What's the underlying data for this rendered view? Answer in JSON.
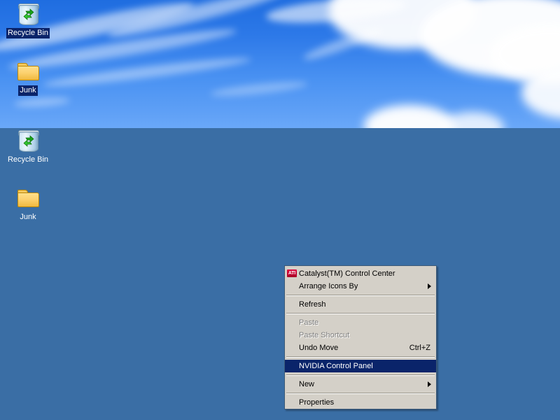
{
  "desktop": {
    "background_color": "#3a6ea5",
    "wallpaper_name": "bliss-sky",
    "icons_top": [
      {
        "name": "Recycle Bin",
        "icon": "recycle-bin-icon",
        "selected": true
      },
      {
        "name": "Junk",
        "icon": "folder-icon",
        "selected": true
      }
    ],
    "icons_bottom": [
      {
        "name": "Recycle Bin",
        "icon": "recycle-bin-icon",
        "selected": false
      },
      {
        "name": "Junk",
        "icon": "folder-icon",
        "selected": false
      }
    ]
  },
  "context_menu": {
    "accent_color": "#0a246a",
    "face_color": "#d4d0c8",
    "border_color": "#3c5a78",
    "items": [
      {
        "label": "Catalyst(TM) Control Center",
        "icon": "ati-logo-icon",
        "icon_text": "ATI",
        "state": "normal",
        "accel": "",
        "submenu": false
      },
      {
        "label": "Arrange Icons By",
        "state": "normal",
        "accel": "",
        "submenu": true
      },
      {
        "separator": true
      },
      {
        "label": "Refresh",
        "state": "normal",
        "accel": "",
        "submenu": false
      },
      {
        "separator": true
      },
      {
        "label": "Paste",
        "state": "disabled",
        "accel": "",
        "submenu": false
      },
      {
        "label": "Paste Shortcut",
        "state": "disabled",
        "accel": "",
        "submenu": false
      },
      {
        "label": "Undo Move",
        "state": "normal",
        "accel": "Ctrl+Z",
        "submenu": false
      },
      {
        "separator": true
      },
      {
        "label": "NVIDIA Control Panel",
        "state": "selected",
        "accel": "",
        "submenu": false
      },
      {
        "separator": true
      },
      {
        "label": "New",
        "state": "normal",
        "accel": "",
        "submenu": true
      },
      {
        "separator": true
      },
      {
        "label": "Properties",
        "state": "normal",
        "accel": "",
        "submenu": false
      }
    ]
  }
}
